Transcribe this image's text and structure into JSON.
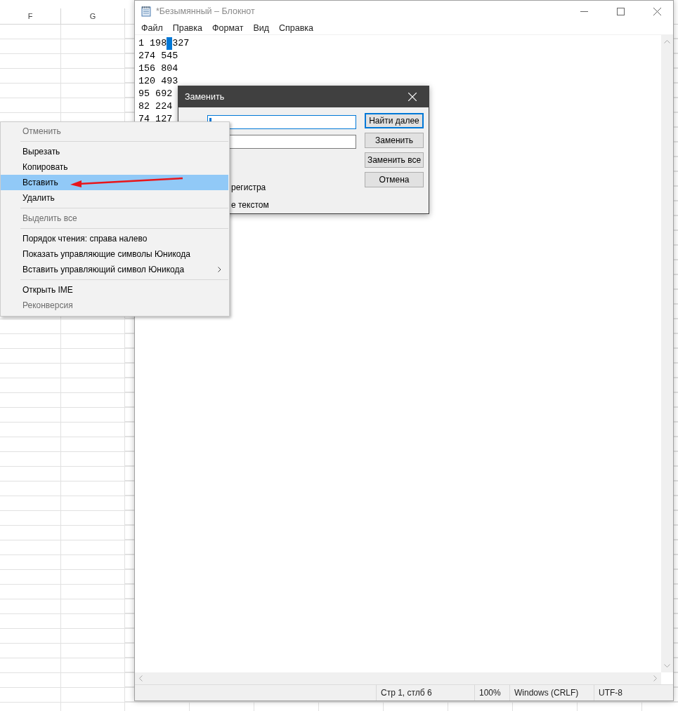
{
  "spreadsheet": {
    "columns": [
      "F",
      "G"
    ]
  },
  "notepad": {
    "title": "*Безымянный – Блокнот",
    "menu": [
      "Файл",
      "Правка",
      "Формат",
      "Вид",
      "Справка"
    ],
    "lines": [
      {
        "segments": [
          {
            "text": "1 198",
            "selection_after": true
          },
          {
            "text": "327",
            "selection_after": false
          }
        ]
      },
      {
        "segments": [
          {
            "text": "274 545",
            "selection_after": false
          }
        ]
      },
      {
        "segments": [
          {
            "text": "156 804",
            "selection_after": false
          }
        ]
      },
      {
        "segments": [
          {
            "text": "120 493",
            "selection_after": false
          }
        ]
      },
      {
        "segments": [
          {
            "text": "95 692",
            "selection_after": false
          }
        ]
      },
      {
        "segments": [
          {
            "text": "82 224",
            "selection_after": false
          }
        ]
      },
      {
        "segments": [
          {
            "text": "74 127",
            "selection_after": false
          }
        ]
      }
    ],
    "status_bar": [
      "Стр 1, стлб 6",
      "100%",
      "Windows (CRLF)",
      "UTF-8"
    ]
  },
  "replace_dialog": {
    "title": "Заменить",
    "fields": [
      {
        "focused": true
      },
      {
        "focused": false
      }
    ],
    "options": [
      "регистра",
      "е текстом"
    ],
    "buttons": [
      {
        "label": "Найти далее",
        "default": true
      },
      {
        "label": "Заменить",
        "default": false
      },
      {
        "label": "Заменить все",
        "default": false
      },
      {
        "label": "Отмена",
        "default": false
      }
    ]
  },
  "context_menu": {
    "items": [
      {
        "kind": "item",
        "label": "Отменить",
        "disabled": true,
        "selected": false,
        "submenu": false
      },
      {
        "kind": "separator"
      },
      {
        "kind": "item",
        "label": "Вырезать",
        "disabled": false,
        "selected": false,
        "submenu": false
      },
      {
        "kind": "item",
        "label": "Копировать",
        "disabled": false,
        "selected": false,
        "submenu": false
      },
      {
        "kind": "item",
        "label": "Вставить",
        "disabled": false,
        "selected": true,
        "submenu": false
      },
      {
        "kind": "item",
        "label": "Удалить",
        "disabled": false,
        "selected": false,
        "submenu": false
      },
      {
        "kind": "separator"
      },
      {
        "kind": "item",
        "label": "Выделить все",
        "disabled": true,
        "selected": false,
        "submenu": false
      },
      {
        "kind": "separator"
      },
      {
        "kind": "item",
        "label": "Порядок чтения: справа налево",
        "disabled": false,
        "selected": false,
        "submenu": false
      },
      {
        "kind": "item",
        "label": "Показать управляющие символы Юникода",
        "disabled": false,
        "selected": false,
        "submenu": false
      },
      {
        "kind": "item",
        "label": "Вставить управляющий символ Юникода",
        "disabled": false,
        "selected": false,
        "submenu": true
      },
      {
        "kind": "separator"
      },
      {
        "kind": "item",
        "label": "Открыть IME",
        "disabled": false,
        "selected": false,
        "submenu": false
      },
      {
        "kind": "item",
        "label": "Реконверсия",
        "disabled": true,
        "selected": false,
        "submenu": false
      }
    ]
  }
}
